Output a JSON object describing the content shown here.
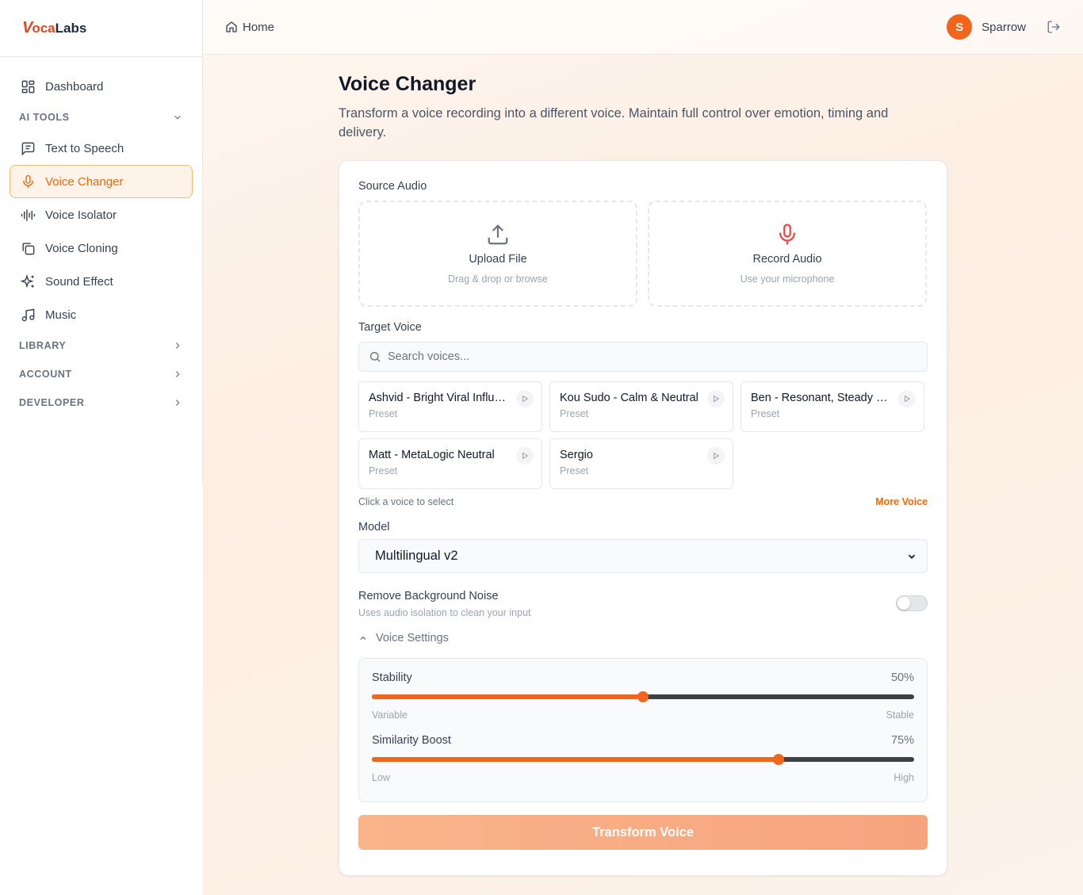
{
  "brand": {
    "v": "V",
    "oca": "oca",
    "labs": "Labs"
  },
  "sidebar": {
    "dashboard": "Dashboard",
    "ai_tools": "AI TOOLS",
    "items": [
      {
        "label": "Text to Speech",
        "icon": "message-square-icon"
      },
      {
        "label": "Voice Changer",
        "icon": "mic-icon"
      },
      {
        "label": "Voice Isolator",
        "icon": "waveform-icon"
      },
      {
        "label": "Voice Cloning",
        "icon": "copy-icon"
      },
      {
        "label": "Sound Effect",
        "icon": "sparkles-icon"
      },
      {
        "label": "Music",
        "icon": "music-icon"
      }
    ],
    "sections": [
      "LIBRARY",
      "ACCOUNT",
      "DEVELOPER"
    ]
  },
  "header": {
    "breadcrumb": "Home",
    "avatar_initial": "S",
    "username": "Sparrow"
  },
  "page": {
    "title": "Voice Changer",
    "subtitle": "Transform a voice recording into a different voice. Maintain full control over emotion, timing and delivery."
  },
  "source": {
    "label": "Source Audio",
    "upload_title": "Upload File",
    "upload_sub": "Drag & drop or browse",
    "record_title": "Record Audio",
    "record_sub": "Use your microphone"
  },
  "target": {
    "label": "Target Voice",
    "search_placeholder": "Search voices...",
    "voices": [
      {
        "name": "Ashvid - Bright Viral Influencer",
        "type": "Preset"
      },
      {
        "name": "Kou Sudo - Calm & Neutral",
        "type": "Preset"
      },
      {
        "name": "Ben - Resonant, Steady Narrator",
        "type": "Preset"
      },
      {
        "name": "Matt - MetaLogic Neutral",
        "type": "Preset"
      },
      {
        "name": "Sergio",
        "type": "Preset"
      }
    ],
    "hint": "Click a voice to select",
    "more": "More Voice"
  },
  "model": {
    "label": "Model",
    "selected": "Multilingual v2"
  },
  "noise": {
    "title": "Remove Background Noise",
    "sub": "Uses audio isolation to clean your input",
    "enabled": false
  },
  "voice_settings": {
    "toggle_label": "Voice Settings",
    "stability": {
      "label": "Stability",
      "value_text": "50%",
      "value": 0.5,
      "low": "Variable",
      "high": "Stable"
    },
    "similarity": {
      "label": "Similarity Boost",
      "value_text": "75%",
      "value": 0.75,
      "low": "Low",
      "high": "High"
    }
  },
  "submit": "Transform Voice",
  "colors": {
    "accent": "#f2651d",
    "brand_red": "#e4461a",
    "active_bg": "#fef3e8"
  }
}
